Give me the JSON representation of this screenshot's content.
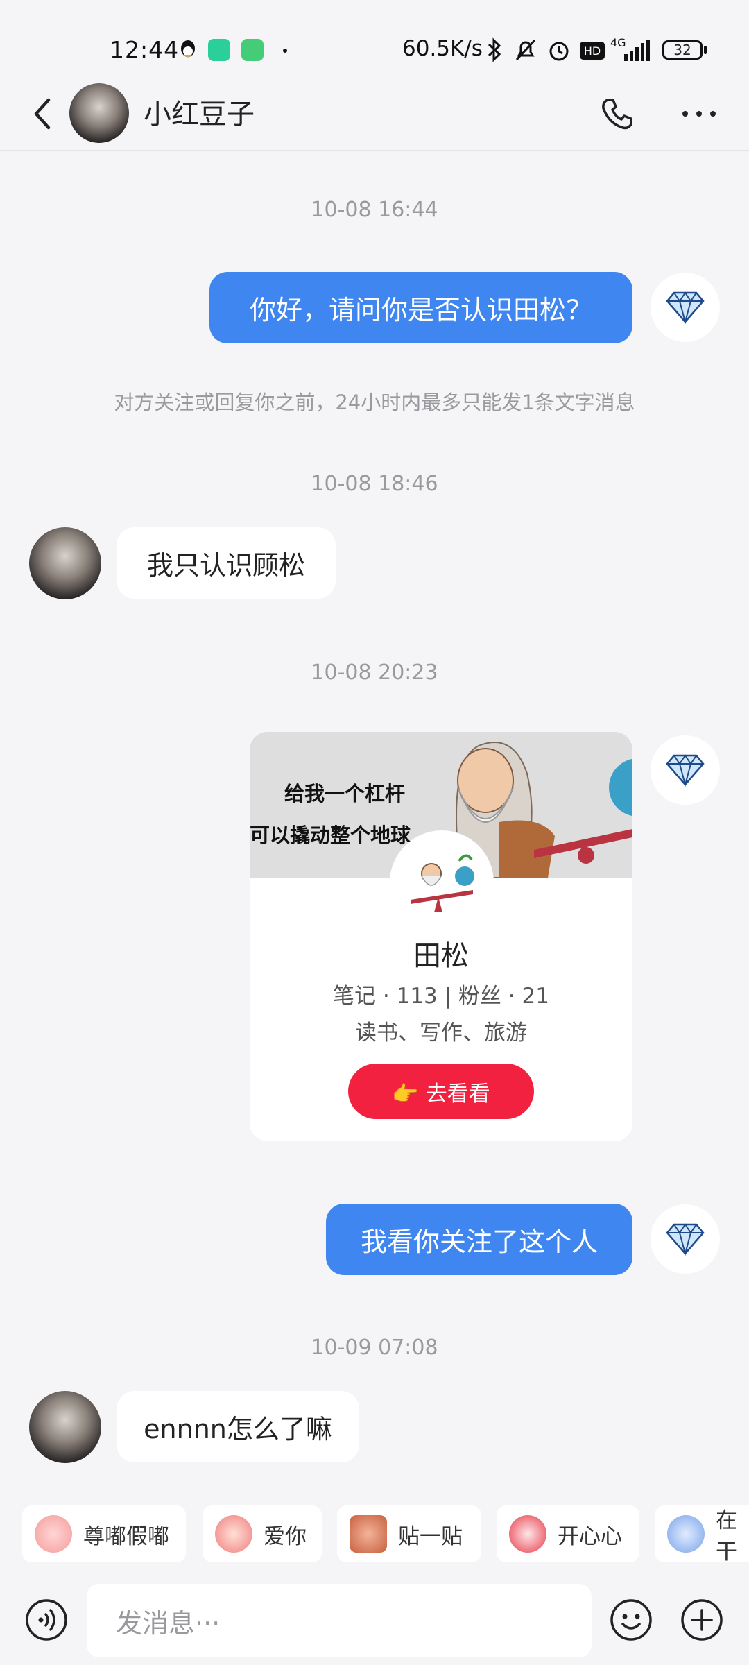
{
  "status_bar": {
    "time": "12:44",
    "network_speed": "60.5K/s",
    "battery": "32",
    "signal_label": "4G",
    "hd_label": "HD"
  },
  "header": {
    "contact_name": "小红豆子"
  },
  "messages": {
    "ts1": "10-08 16:44",
    "msg1": "你好，请问你是否认识田松？",
    "notice": "对方关注或回复你之前，24小时内最多只能发1条文字消息",
    "ts2": "10-08 18:46",
    "msg2": "我只认识顾松",
    "ts3": "10-08 20:23",
    "ts4": "10-09 07:08",
    "msg3": "我看你关注了这个人",
    "msg4": "ennnn怎么了嘛"
  },
  "card": {
    "banner_line1": "给我一个杠杆",
    "banner_line2": "可以撬动整个地球",
    "name": "田松",
    "stats": "笔记 · 113  |  粉丝 · 21",
    "tags": "读书、写作、旅游",
    "button_label": "👉 去看看"
  },
  "quick_replies": [
    "尊嘟假嘟",
    "爱你",
    "贴一贴",
    "开心心",
    "在干"
  ],
  "input": {
    "placeholder": "发消息···"
  },
  "colors": {
    "accent_blue": "#3f86f0",
    "accent_red": "#f1213f",
    "background": "#f5f5f7"
  }
}
